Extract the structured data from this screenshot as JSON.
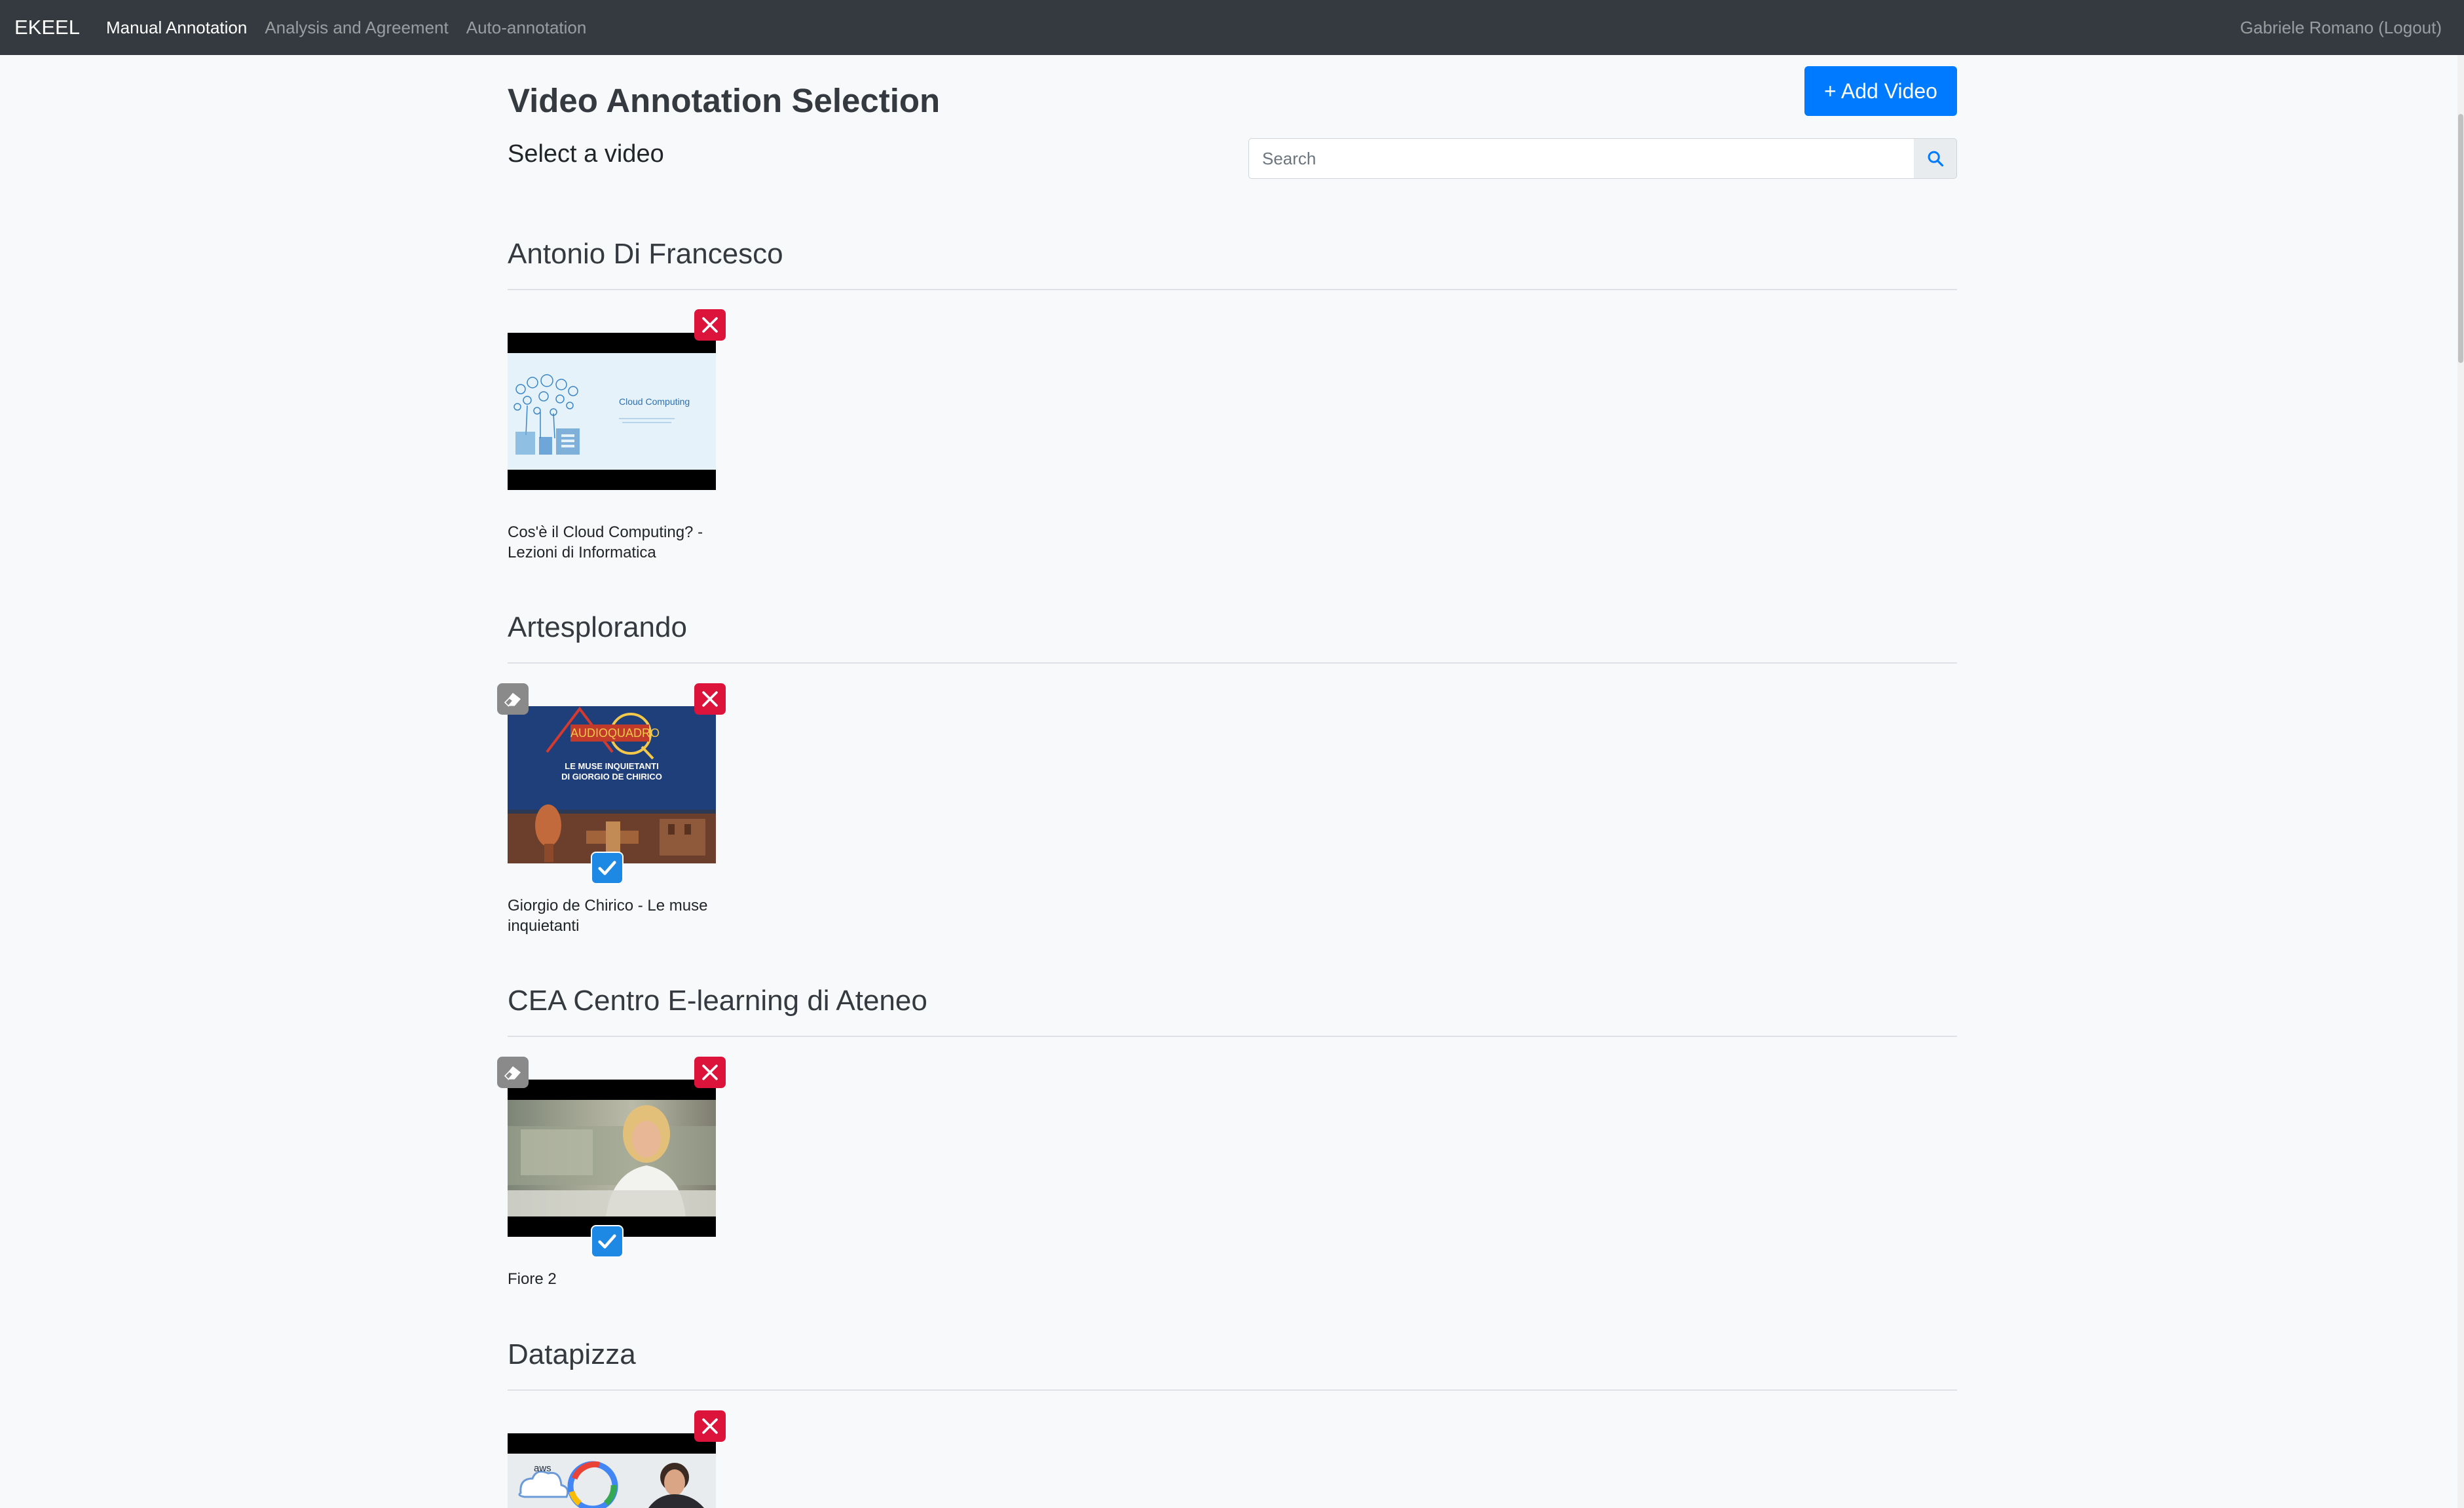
{
  "navbar": {
    "brand": "EKEEL",
    "links": [
      {
        "label": "Manual Annotation",
        "active": true
      },
      {
        "label": "Analysis and Agreement",
        "active": false
      },
      {
        "label": "Auto-annotation",
        "active": false
      }
    ],
    "user": "Gabriele Romano (Logout)"
  },
  "header": {
    "title": "Video Annotation Selection",
    "subtitle": "Select a video",
    "add_button_label": "+ Add Video",
    "search_placeholder": "Search"
  },
  "sections": [
    {
      "channel": "Antonio Di Francesco",
      "videos": [
        {
          "title": "Cos'è il Cloud Computing? - Lezioni di Informatica",
          "thumbnail_text": "Cloud Computing",
          "has_erase": false,
          "checked": false
        }
      ]
    },
    {
      "channel": "Artesplorando",
      "videos": [
        {
          "title": "Giorgio de Chirico - Le muse inquietanti",
          "thumbnail_text": [
            "AUDIOQUADRO",
            "LE MUSE INQUIETANTI",
            "DI GIORGIO DE CHIRICO"
          ],
          "has_erase": true,
          "checked": true
        }
      ]
    },
    {
      "channel": "CEA Centro E-learning di Ateneo",
      "videos": [
        {
          "title": "Fiore 2",
          "has_erase": true,
          "checked": true
        }
      ]
    },
    {
      "channel": "Datapizza",
      "videos": [
        {
          "title": "",
          "thumbnail_text": "aws",
          "has_erase": false,
          "checked": false
        }
      ]
    }
  ],
  "icons": {
    "delete": "close-icon",
    "erase": "eraser-icon",
    "checked": "check-icon",
    "search": "search-icon"
  },
  "colors": {
    "navbar": "#343a40",
    "primary": "#007bff",
    "delete": "#dc143c",
    "check": "#1e88e5"
  }
}
